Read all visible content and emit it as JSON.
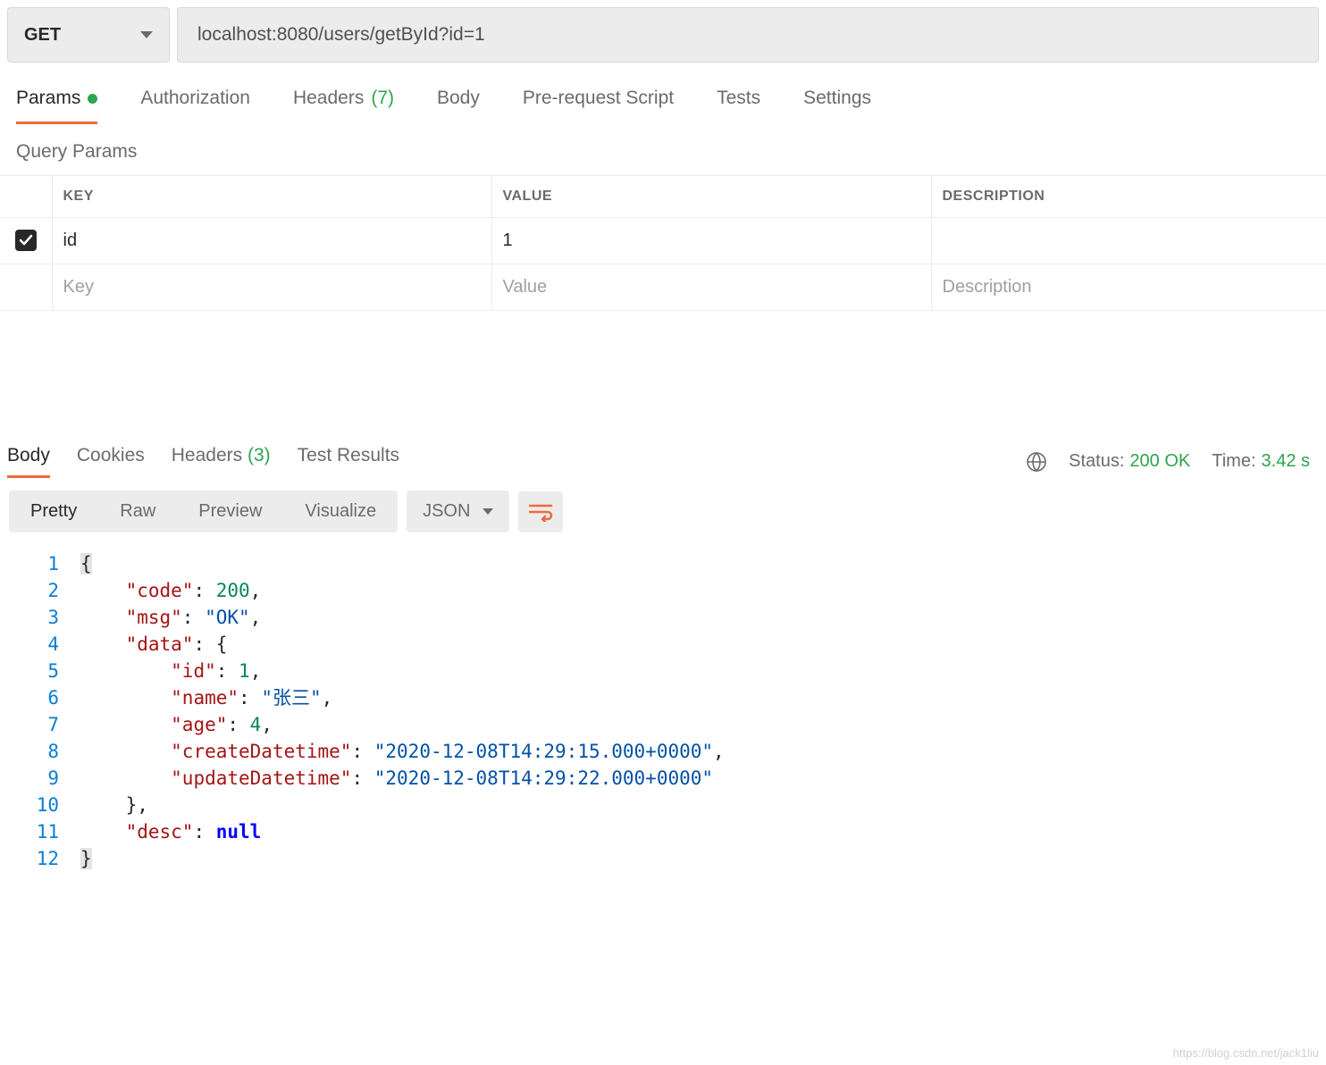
{
  "request": {
    "method": "GET",
    "url": "localhost:8080/users/getById?id=1"
  },
  "tabs": {
    "params": "Params",
    "auth": "Authorization",
    "headers": "Headers",
    "headers_count": "(7)",
    "body": "Body",
    "prerequest": "Pre-request Script",
    "tests": "Tests",
    "settings": "Settings"
  },
  "query_params": {
    "title": "Query Params",
    "header_key": "KEY",
    "header_value": "VALUE",
    "header_desc": "DESCRIPTION",
    "rows": [
      {
        "key": "id",
        "value": "1",
        "desc": ""
      }
    ],
    "placeholder_key": "Key",
    "placeholder_value": "Value",
    "placeholder_desc": "Description"
  },
  "response": {
    "tabs": {
      "body": "Body",
      "cookies": "Cookies",
      "headers": "Headers",
      "headers_count": "(3)",
      "test_results": "Test Results"
    },
    "status_label": "Status:",
    "status_value": "200 OK",
    "time_label": "Time:",
    "time_value": "3.42 s",
    "view_modes": {
      "pretty": "Pretty",
      "raw": "Raw",
      "preview": "Preview",
      "visualize": "Visualize"
    },
    "format": "JSON",
    "json_lines": [
      {
        "n": "1",
        "tokens": [
          [
            "brace",
            "{"
          ]
        ]
      },
      {
        "n": "2",
        "tokens": [
          [
            "indent",
            "    "
          ],
          [
            "key",
            "\"code\""
          ],
          [
            "punc",
            ": "
          ],
          [
            "num",
            "200"
          ],
          [
            "punc",
            ","
          ]
        ]
      },
      {
        "n": "3",
        "tokens": [
          [
            "indent",
            "    "
          ],
          [
            "key",
            "\"msg\""
          ],
          [
            "punc",
            ": "
          ],
          [
            "str",
            "\"OK\""
          ],
          [
            "punc",
            ","
          ]
        ]
      },
      {
        "n": "4",
        "tokens": [
          [
            "indent",
            "    "
          ],
          [
            "key",
            "\"data\""
          ],
          [
            "punc",
            ": "
          ],
          [
            "brace",
            "{"
          ]
        ]
      },
      {
        "n": "5",
        "tokens": [
          [
            "indent",
            "        "
          ],
          [
            "key",
            "\"id\""
          ],
          [
            "punc",
            ": "
          ],
          [
            "num",
            "1"
          ],
          [
            "punc",
            ","
          ]
        ]
      },
      {
        "n": "6",
        "tokens": [
          [
            "indent",
            "        "
          ],
          [
            "key",
            "\"name\""
          ],
          [
            "punc",
            ": "
          ],
          [
            "str",
            "\"张三\""
          ],
          [
            "punc",
            ","
          ]
        ]
      },
      {
        "n": "7",
        "tokens": [
          [
            "indent",
            "        "
          ],
          [
            "key",
            "\"age\""
          ],
          [
            "punc",
            ": "
          ],
          [
            "num",
            "4"
          ],
          [
            "punc",
            ","
          ]
        ]
      },
      {
        "n": "8",
        "tokens": [
          [
            "indent",
            "        "
          ],
          [
            "key",
            "\"createDatetime\""
          ],
          [
            "punc",
            ": "
          ],
          [
            "str",
            "\"2020-12-08T14:29:15.000+0000\""
          ],
          [
            "punc",
            ","
          ]
        ]
      },
      {
        "n": "9",
        "tokens": [
          [
            "indent",
            "        "
          ],
          [
            "key",
            "\"updateDatetime\""
          ],
          [
            "punc",
            ": "
          ],
          [
            "str",
            "\"2020-12-08T14:29:22.000+0000\""
          ]
        ]
      },
      {
        "n": "10",
        "tokens": [
          [
            "indent",
            "    "
          ],
          [
            "brace",
            "}"
          ],
          [
            "punc",
            ","
          ]
        ]
      },
      {
        "n": "11",
        "tokens": [
          [
            "indent",
            "    "
          ],
          [
            "key",
            "\"desc\""
          ],
          [
            "punc",
            ": "
          ],
          [
            "null",
            "null"
          ]
        ]
      },
      {
        "n": "12",
        "tokens": [
          [
            "brace",
            "}"
          ]
        ]
      }
    ]
  },
  "watermark": "https://blog.csdn.net/jack1liu"
}
